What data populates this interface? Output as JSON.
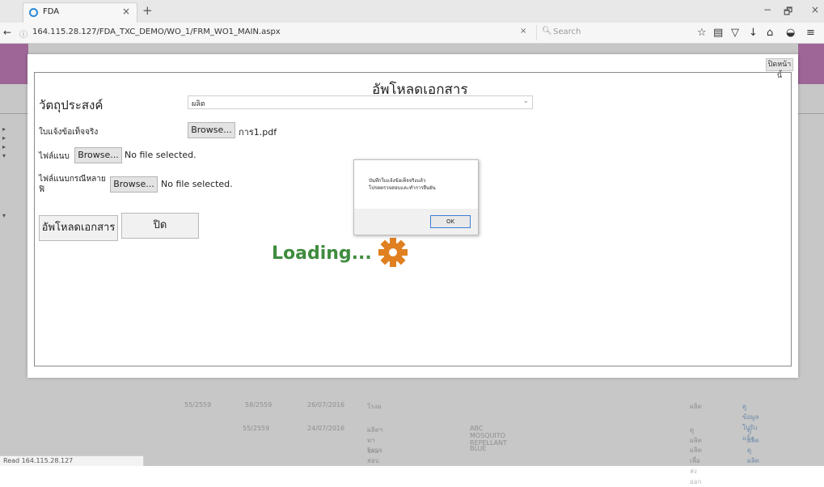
{
  "browser": {
    "tab_title": "FDA",
    "tab_close": "×",
    "new_tab": "+",
    "minimize": "−",
    "restore": "🗗",
    "close": "×",
    "url": "164.115.28.127/FDA_TXC_DEMO/WO_1/FRM_WO1_MAIN.aspx",
    "url_clear": "×",
    "search_placeholder": "Search",
    "status": "Read 164.115.28.127"
  },
  "page": {
    "close_page_label": "ปิดหน้านี้",
    "title": "อัพโหลดเอกสาร",
    "purpose_label": "วัตถุประสงค์",
    "purpose_value": "ผลิต",
    "fields": [
      {
        "label": "ใบแจ้งข้อเท็จจริง",
        "button": "Browse...",
        "file": "การ1.pdf"
      },
      {
        "label": "ไฟล์แนบ",
        "button": "Browse...",
        "file": "No file selected."
      },
      {
        "label": "ไฟล์แนบกรณีหลาย\nฟิ",
        "button": "Browse...",
        "file": "No file selected."
      }
    ],
    "upload_button": "อัพโหลดเอกสาร",
    "close_button": "ปิด",
    "loading_text": "Loading..."
  },
  "alert": {
    "line1": "บันทึกใบแจ้งข้อเท็จจริงแล้ว",
    "line2": "โปรดตรวจสอบและทำการยืนยัน",
    "ok_label": "OK"
  },
  "background_rows": [
    {
      "c1": "55/2559",
      "c2": "58/2559",
      "c3": "26/07/2016",
      "c4": "โรงม",
      "c5": "",
      "c6": "ผลิต",
      "c7": "ดูข้อมูลใบรับแจ้ง"
    },
    {
      "c1": "",
      "c2": "55/2559",
      "c3": "24/07/2016",
      "c4": "ผลิตฯ ทาโลม",
      "c5": "ABC MOSQUITO REPELLANT",
      "c6": "ดูผลิต",
      "c7": "ดูผลิต"
    },
    {
      "c1": "",
      "c2": "",
      "c3": "",
      "c4": "ตรวจสอบ",
      "c5": "BLUE",
      "c6": "ผลิตเพื่อส่งออก",
      "c7": "ดูผลิต"
    }
  ],
  "colors": {
    "accent_pink": "#c983c0",
    "loading_green": "#3f8c3f",
    "gear_orange": "#e08020",
    "ok_focus": "#3c7fd6"
  }
}
